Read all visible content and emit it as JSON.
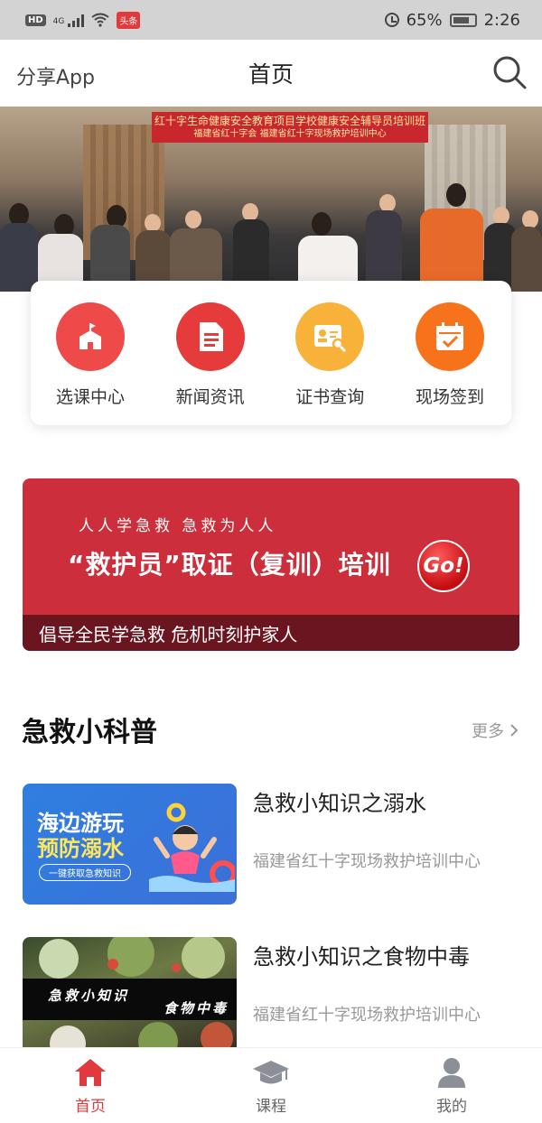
{
  "status_bar": {
    "hd": "HD",
    "net": "4G",
    "news": "头条",
    "battery": "65%",
    "time": "2:26"
  },
  "nav": {
    "share_label": "分享App",
    "title": "首页"
  },
  "hero": {
    "banner_line1": "红十字生命健康安全教育项目学校健康安全辅导员培训班",
    "banner_line2": "福建省红十字会  福建省红十字现场救护培训中心"
  },
  "menu": [
    {
      "label": "选课中心",
      "icon": "school-icon",
      "color": "#ee4a4a"
    },
    {
      "label": "新闻资讯",
      "icon": "document-icon",
      "color": "#e63b3b"
    },
    {
      "label": "证书查询",
      "icon": "certificate-icon",
      "color": "#f8b23a"
    },
    {
      "label": "现场签到",
      "icon": "calendar-check-icon",
      "color": "#f7731b"
    }
  ],
  "promo": {
    "subtitle": "人人学急救  急救为人人",
    "title": "“救护员”取证（复训）培训",
    "go": "Go!",
    "footer": "倡导全民学急救 危机时刻护家人",
    "color": "#cc2f3b"
  },
  "section": {
    "title": "急救小科普",
    "more": "更多"
  },
  "articles": [
    {
      "title": "急救小知识之溺水",
      "source": "福建省红十字现场救护培训中心",
      "thumb_line1": "海边游玩",
      "thumb_line2": "预防溺水",
      "thumb_pill": "一键获取急救知识"
    },
    {
      "title": "急救小知识之食物中毒",
      "source": "福建省红十字现场救护培训中心",
      "thumb_a": "急救小知识",
      "thumb_b": "食物中毒"
    }
  ],
  "tabs": [
    {
      "label": "首页",
      "icon": "home-icon",
      "active": true
    },
    {
      "label": "课程",
      "icon": "graduation-cap-icon",
      "active": false
    },
    {
      "label": "我的",
      "icon": "user-icon",
      "active": false
    }
  ],
  "accent": "#e0393e"
}
